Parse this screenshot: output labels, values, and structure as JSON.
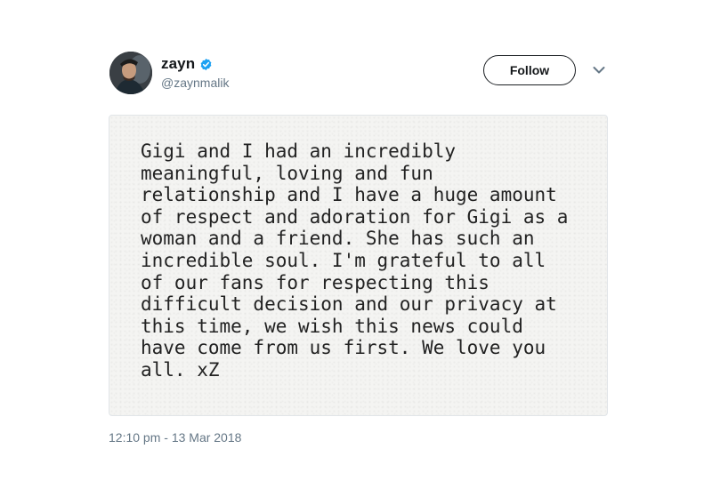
{
  "author": {
    "display_name": "zayn",
    "handle": "@zaynmalik",
    "verified": true
  },
  "actions": {
    "follow_label": "Follow",
    "menu_icon": "chevron-down-icon"
  },
  "tweet": {
    "image_text_lines": [
      "Gigi and I had an incredibly",
      "meaningful, loving and fun",
      "relationship and I have a huge amount",
      "of respect and adoration for Gigi as a",
      "woman and a friend. She has such an",
      "incredible soul. I'm grateful to all",
      "of our fans for respecting this",
      "difficult decision and our privacy at",
      "this time, we wish this news could",
      "have come from us first. We love you",
      "all. xZ"
    ],
    "timestamp": "12:10 pm - 13 Mar 2018"
  },
  "colors": {
    "verified_blue": "#1da1f2",
    "secondary_text": "#657786",
    "card_background": "#f4f4f2"
  }
}
